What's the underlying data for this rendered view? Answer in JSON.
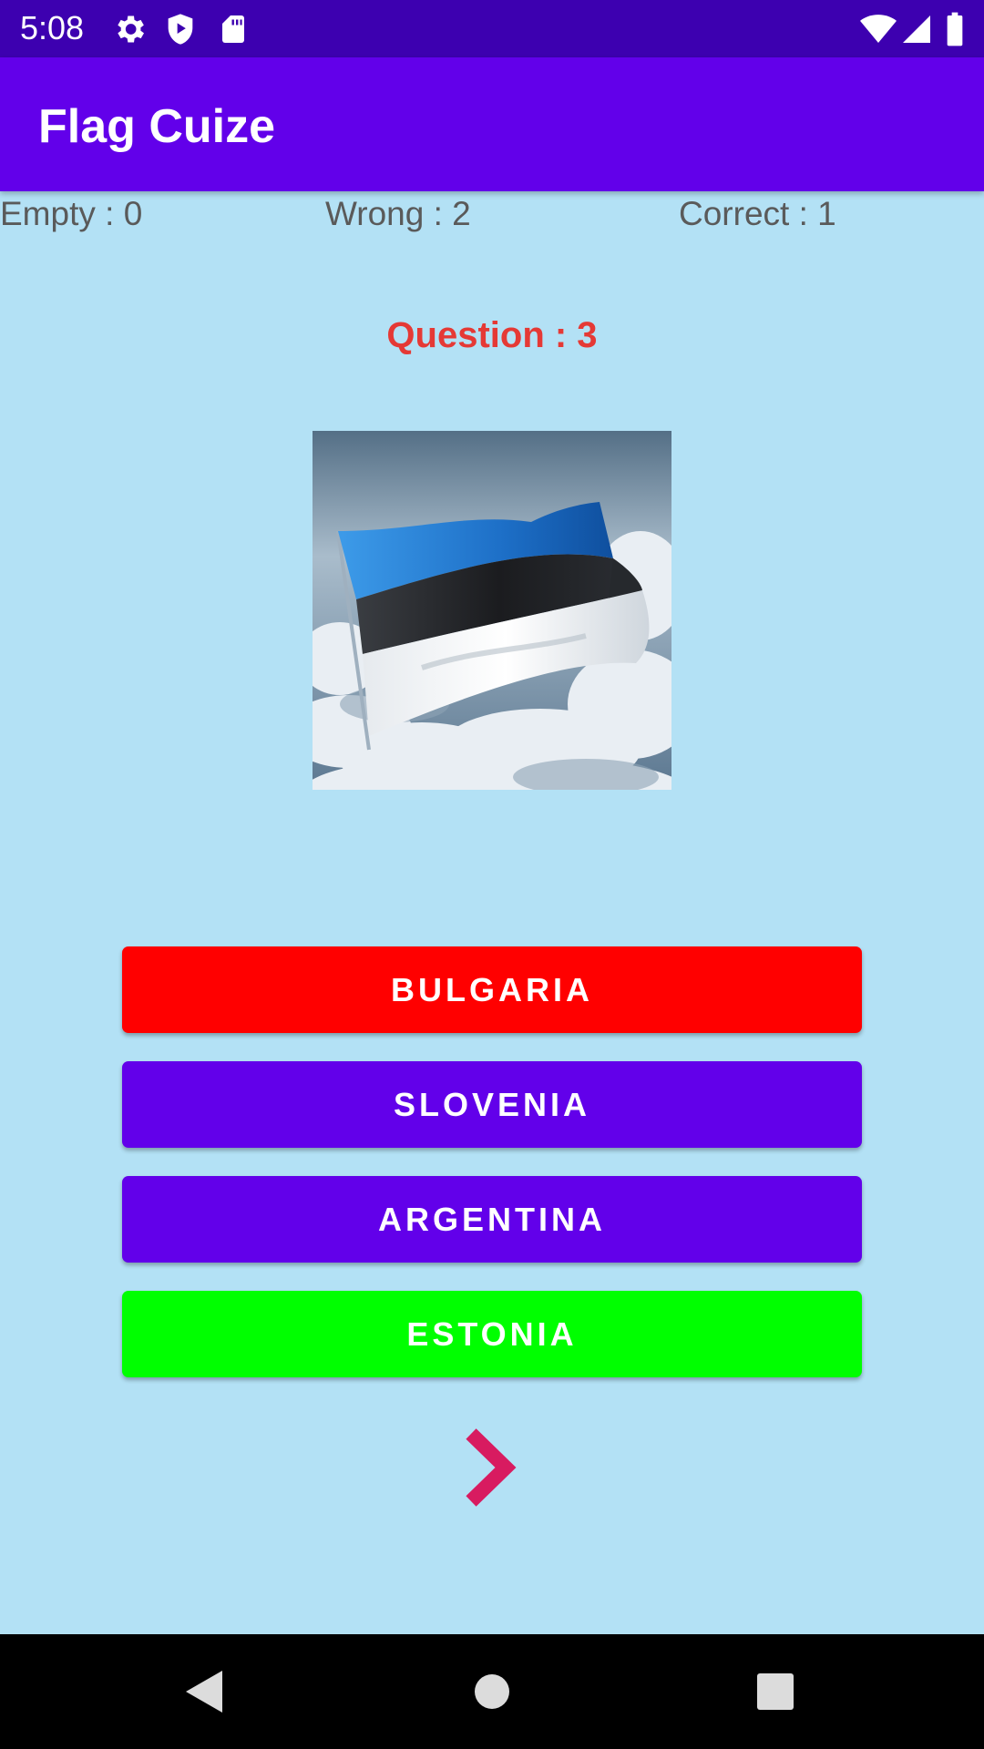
{
  "status_bar": {
    "time": "5:08",
    "icons": [
      "gear-icon",
      "shield-play-icon",
      "sd-card-icon",
      "wifi-icon",
      "signal-icon",
      "battery-icon"
    ]
  },
  "app_bar": {
    "title": "Flag Cuize"
  },
  "scores": {
    "empty": "Empty : 0",
    "wrong": "Wrong : 2",
    "correct": "Correct : 1"
  },
  "question": {
    "label": "Question : 3"
  },
  "flag": {
    "image": "estonia-flag-in-clouds",
    "colors": [
      "#1a7fd6",
      "#1f1f1f",
      "#ffffff"
    ]
  },
  "answers": [
    {
      "label": "BULGARIA",
      "color": "#ff0000"
    },
    {
      "label": "SLOVENIA",
      "color": "#6200ea"
    },
    {
      "label": "ARGENTINA",
      "color": "#6200ea"
    },
    {
      "label": "ESTONIA",
      "color": "#00ff00"
    }
  ],
  "next": {
    "icon": "chevron-right-icon",
    "color": "#d81b60"
  },
  "nav_bar": {
    "icons": [
      "back-icon",
      "home-icon",
      "recents-icon"
    ]
  },
  "colors": {
    "background": "#b3e1f5",
    "status_bar": "#3d00b0",
    "app_bar": "#6200ea",
    "question": "#e53935",
    "score_text": "#5a5a5a"
  }
}
